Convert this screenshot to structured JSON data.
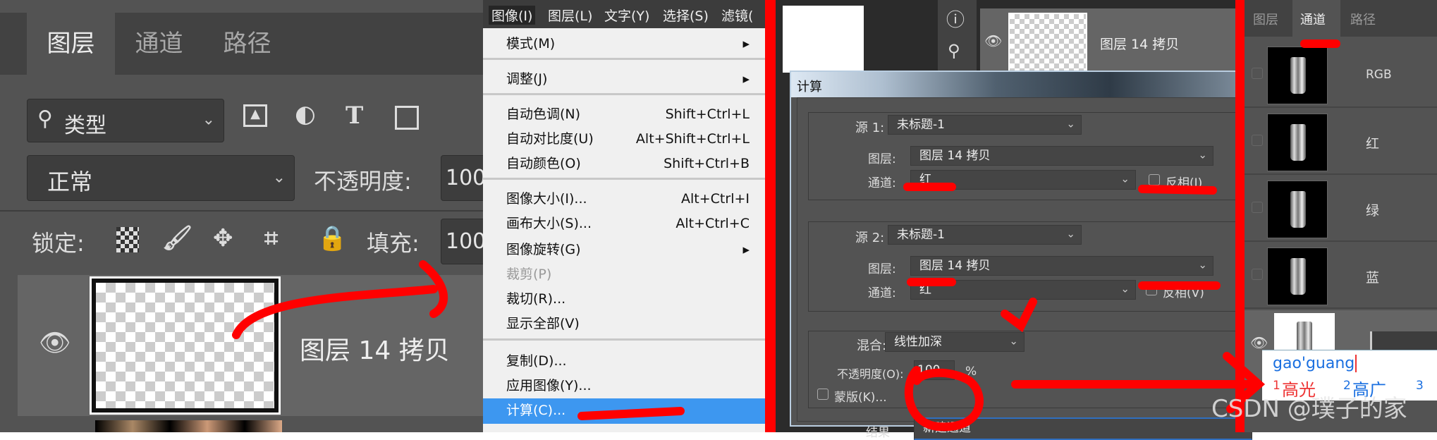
{
  "layers_panel": {
    "tabs": [
      {
        "label": "图层",
        "active": true
      },
      {
        "label": "通道"
      },
      {
        "label": "路径"
      }
    ],
    "filter": {
      "icon": "search-icon",
      "value": "类型"
    },
    "blend_mode": "正常",
    "opacity_label": "不透明度:",
    "opacity_value": "100",
    "lock_label": "锁定:",
    "fill_label": "填充:",
    "fill_value": "100",
    "layer_name": "图层 14 拷贝"
  },
  "image_menu": {
    "menubar": [
      "图像(I)",
      "图层(L)",
      "文字(Y)",
      "选择(S)",
      "滤镜("
    ],
    "items": [
      {
        "label": "模式(M)",
        "submenu": true
      },
      {
        "label": "调整(J)",
        "submenu": true
      },
      {
        "label": "自动色调(N)",
        "shortcut": "Shift+Ctrl+L"
      },
      {
        "label": "自动对比度(U)",
        "shortcut": "Alt+Shift+Ctrl+L"
      },
      {
        "label": "自动颜色(O)",
        "shortcut": "Shift+Ctrl+B"
      },
      {
        "label": "图像大小(I)...",
        "shortcut": "Alt+Ctrl+I"
      },
      {
        "label": "画布大小(S)...",
        "shortcut": "Alt+Ctrl+C"
      },
      {
        "label": "图像旋转(G)",
        "submenu": true
      },
      {
        "label": "裁剪(P)",
        "disabled": true
      },
      {
        "label": "裁切(R)..."
      },
      {
        "label": "显示全部(V)"
      },
      {
        "label": "复制(D)..."
      },
      {
        "label": "应用图像(Y)..."
      },
      {
        "label": "计算(C)...",
        "highlighted": true
      }
    ]
  },
  "background_layer_name": "图层 14 拷贝",
  "calc_dialog": {
    "title": "计算",
    "source1": {
      "label": "源 1:",
      "doc": "未标题-1",
      "layer_label": "图层:",
      "layer": "图层 14 拷贝",
      "channel_label": "通道:",
      "channel": "红",
      "invert": "反相(I)"
    },
    "source2": {
      "label": "源 2:",
      "doc": "未标题-1",
      "layer_label": "图层:",
      "layer": "图层 14 拷贝",
      "channel_label": "通道:",
      "channel": "红",
      "invert": "反相(V)"
    },
    "blend_label": "混合:",
    "blend": "线性加深",
    "opacity_label": "不透明度(O):",
    "opacity": "100",
    "percent": "%",
    "mask": "蒙版(K)...",
    "result_label": "结果",
    "result": "新建通道"
  },
  "channels_panel": {
    "tabs": [
      {
        "label": "图层"
      },
      {
        "label": "通道",
        "active": true
      },
      {
        "label": "路径"
      }
    ],
    "channels": [
      "RGB",
      "红",
      "绿",
      "蓝"
    ]
  },
  "ime": {
    "input": "gao'guang",
    "candidates": [
      {
        "n": "1",
        "text": "高光"
      },
      {
        "n": "2",
        "text": "高广"
      },
      {
        "n": "3",
        "text": ""
      }
    ]
  },
  "watermark": "CSDN @璞子的家",
  "colors": {
    "annotation": "#ff0000",
    "menu_highlight": "#3d97f0",
    "panel_bg": "#535353"
  }
}
